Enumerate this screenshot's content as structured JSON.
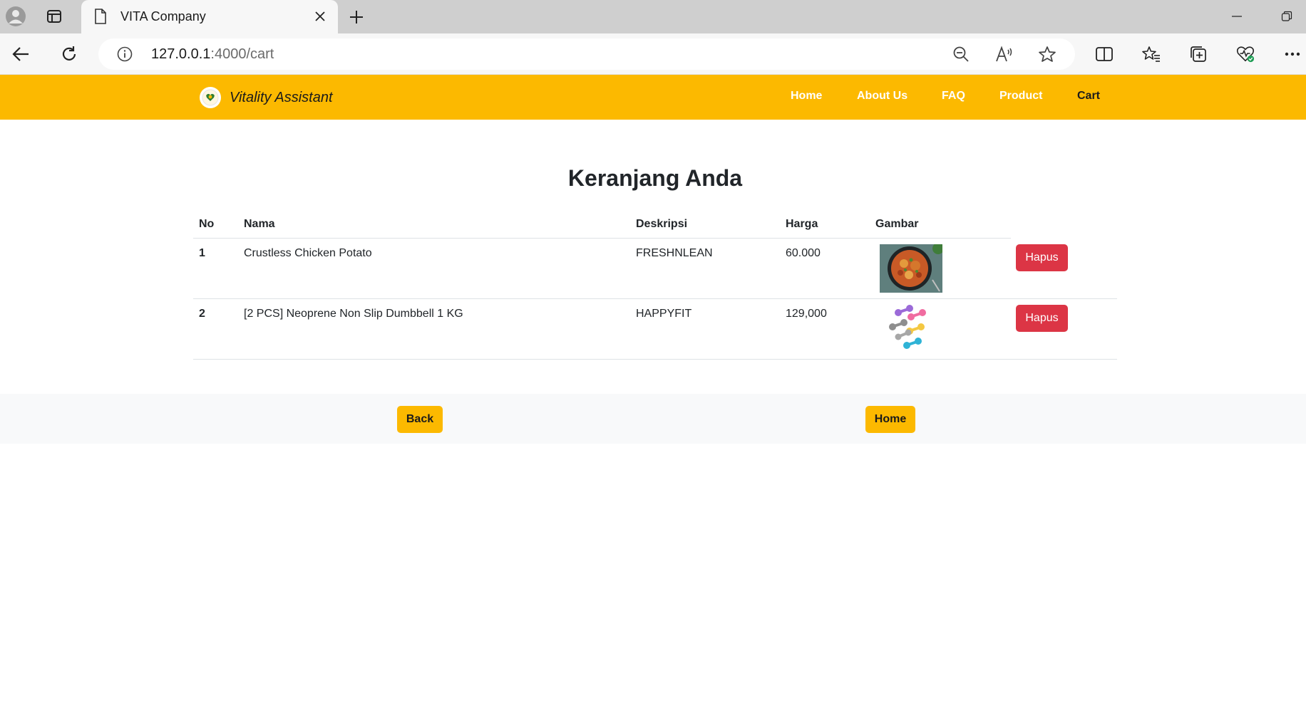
{
  "browser": {
    "tab_title": "VITA Company",
    "url_host": "127.0.0.1",
    "url_path": ":4000/cart"
  },
  "header": {
    "brand": "Vitality Assistant",
    "menu": [
      {
        "label": "Home"
      },
      {
        "label": "About Us"
      },
      {
        "label": "FAQ"
      },
      {
        "label": "Product"
      },
      {
        "label": "Cart"
      }
    ],
    "brand_color": "#fcb900"
  },
  "main": {
    "title": "Keranjang Anda",
    "columns": [
      "No",
      "Nama",
      "Deskripsi",
      "Harga",
      "Gambar"
    ],
    "rows": [
      {
        "no": "1",
        "nama": "Crustless Chicken Potato",
        "deskripsi": "FRESHNLEAN",
        "harga": "60.000",
        "gambar": "chicken-potato-dish-image",
        "action": "Hapus"
      },
      {
        "no": "2",
        "nama": "[2 PCS] Neoprene Non Slip Dumbbell 1 KG",
        "deskripsi": "HAPPYFIT",
        "harga": "129,000",
        "gambar": "dumbbells-image",
        "action": "Hapus"
      }
    ],
    "delete_color": "#dc3545"
  },
  "footer": {
    "back_label": "Back",
    "home_label": "Home"
  }
}
